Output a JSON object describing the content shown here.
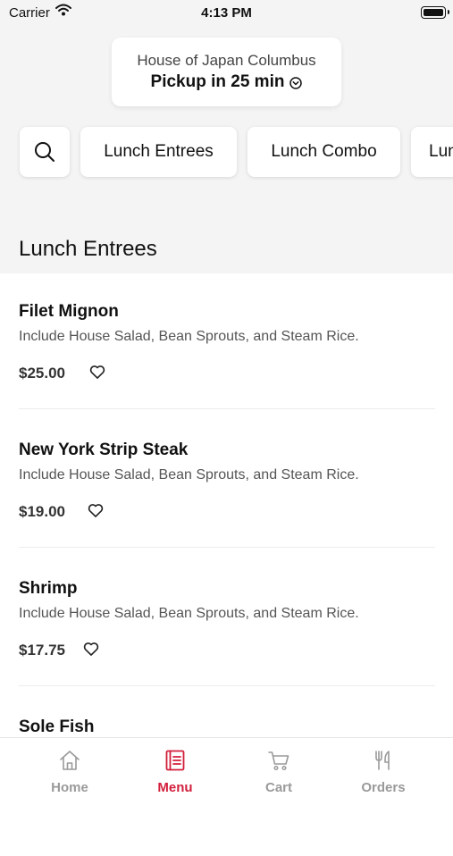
{
  "status_bar": {
    "carrier": "Carrier",
    "time": "4:13 PM"
  },
  "store": {
    "name": "House of Japan Columbus",
    "pickup": "Pickup in 25 min"
  },
  "categories": [
    {
      "label": "Lunch Entrees"
    },
    {
      "label": "Lunch Combo"
    },
    {
      "label": "Lunch Specials"
    }
  ],
  "section": {
    "title": "Lunch Entrees"
  },
  "items": [
    {
      "name": "Filet Mignon",
      "description": "Include House Salad, Bean Sprouts, and Steam Rice.",
      "price": "$25.00"
    },
    {
      "name": "New York Strip Steak",
      "description": "Include House Salad, Bean Sprouts, and Steam Rice.",
      "price": "$19.00"
    },
    {
      "name": "Shrimp",
      "description": "Include House Salad, Bean Sprouts, and Steam Rice.",
      "price": "$17.75"
    },
    {
      "name": "Sole Fish",
      "description": "",
      "price": ""
    }
  ],
  "tabs": [
    {
      "label": "Home",
      "icon": "home-icon"
    },
    {
      "label": "Menu",
      "icon": "menu-book-icon",
      "active": true
    },
    {
      "label": "Cart",
      "icon": "cart-icon"
    },
    {
      "label": "Orders",
      "icon": "fork-knife-icon"
    }
  ],
  "colors": {
    "accent": "#d21f3c",
    "inactive_tab": "#9a9a9a",
    "top_background": "#f4f4f4"
  }
}
